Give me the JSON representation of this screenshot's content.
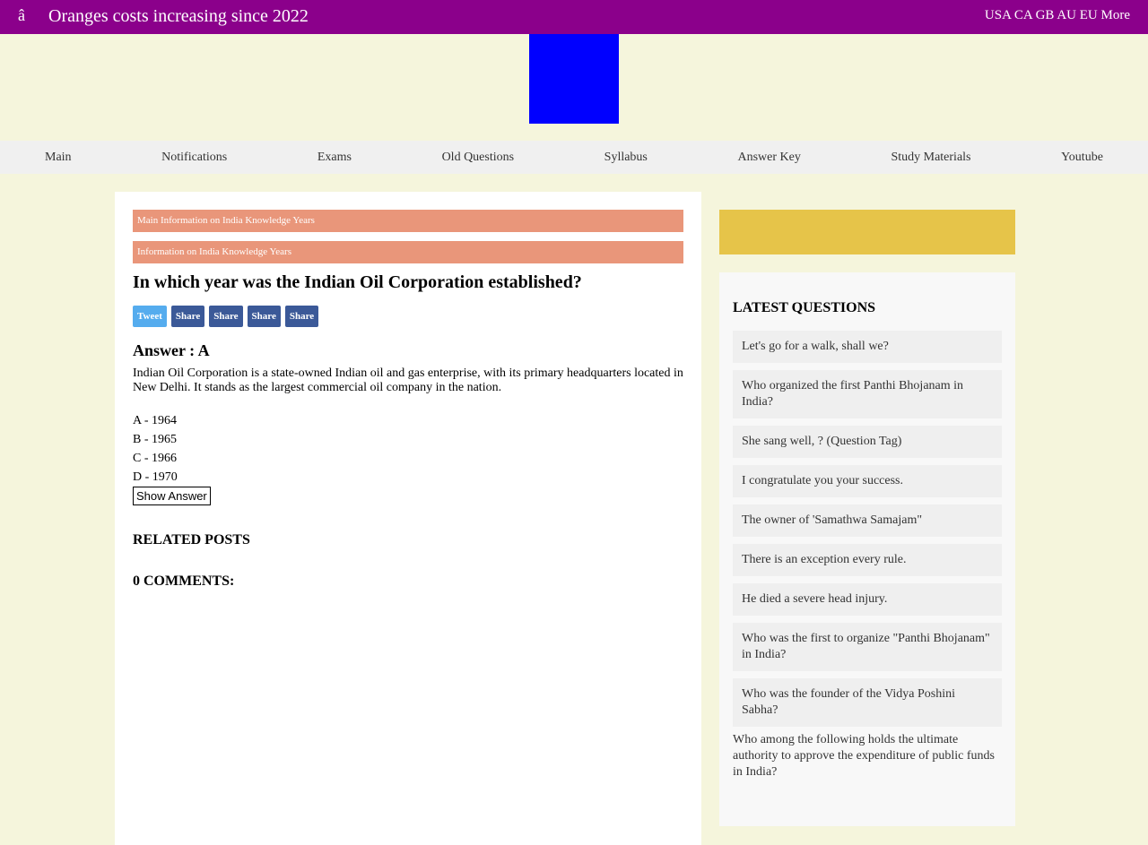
{
  "topbar": {
    "menu_glyph": "â",
    "ticker": "Oranges costs increasing since 2022",
    "regions": "USA CA GB AU EU More"
  },
  "nav": [
    "Main",
    "Notifications",
    "Exams",
    "Old Questions",
    "Syllabus",
    "Answer Key",
    "Study Materials",
    "Youtube"
  ],
  "article": {
    "crumbs": [
      "Main Information on India Knowledge Years",
      "Information on India Knowledge Years"
    ],
    "question": "In which year was the Indian Oil Corporation established?",
    "share": [
      "Tweet",
      "Share",
      "Share",
      "Share",
      "Share"
    ],
    "answer_title": "Answer : A",
    "explanation": "Indian Oil Corporation is a state-owned Indian oil and gas enterprise, with its primary headquarters located in New Delhi. It stands as the largest commercial oil company in the nation.",
    "options": [
      "A - 1964",
      "B - 1965",
      "C - 1966",
      "D - 1970"
    ],
    "show_answer": "Show Answer",
    "related": "RELATED POSTS",
    "comments": "0 COMMENTS:"
  },
  "sidebar": {
    "heading": "LATEST QUESTIONS",
    "items": [
      "Let's go for a walk, shall we?",
      "Who organized the first Panthi Bhojanam in India?",
      "She sang well, ? (Question Tag)",
      "I congratulate you your success.",
      "The owner of 'Samathwa Samajam\"",
      "There is an exception every rule.",
      "He died a severe head injury.",
      "Who was the first to organize \"Panthi Bhojanam\" in India?",
      "Who was the founder of the Vidya Poshini Sabha?"
    ],
    "last_item": "Who among the following holds the ultimate authority to approve the expenditure of public funds in India?"
  },
  "colors": {
    "topbar": "#8b008b",
    "logo": "#0000ff",
    "crumb": "#e9967a",
    "tweet": "#55acee",
    "share": "#3b5998",
    "banner": "#e6c449"
  }
}
